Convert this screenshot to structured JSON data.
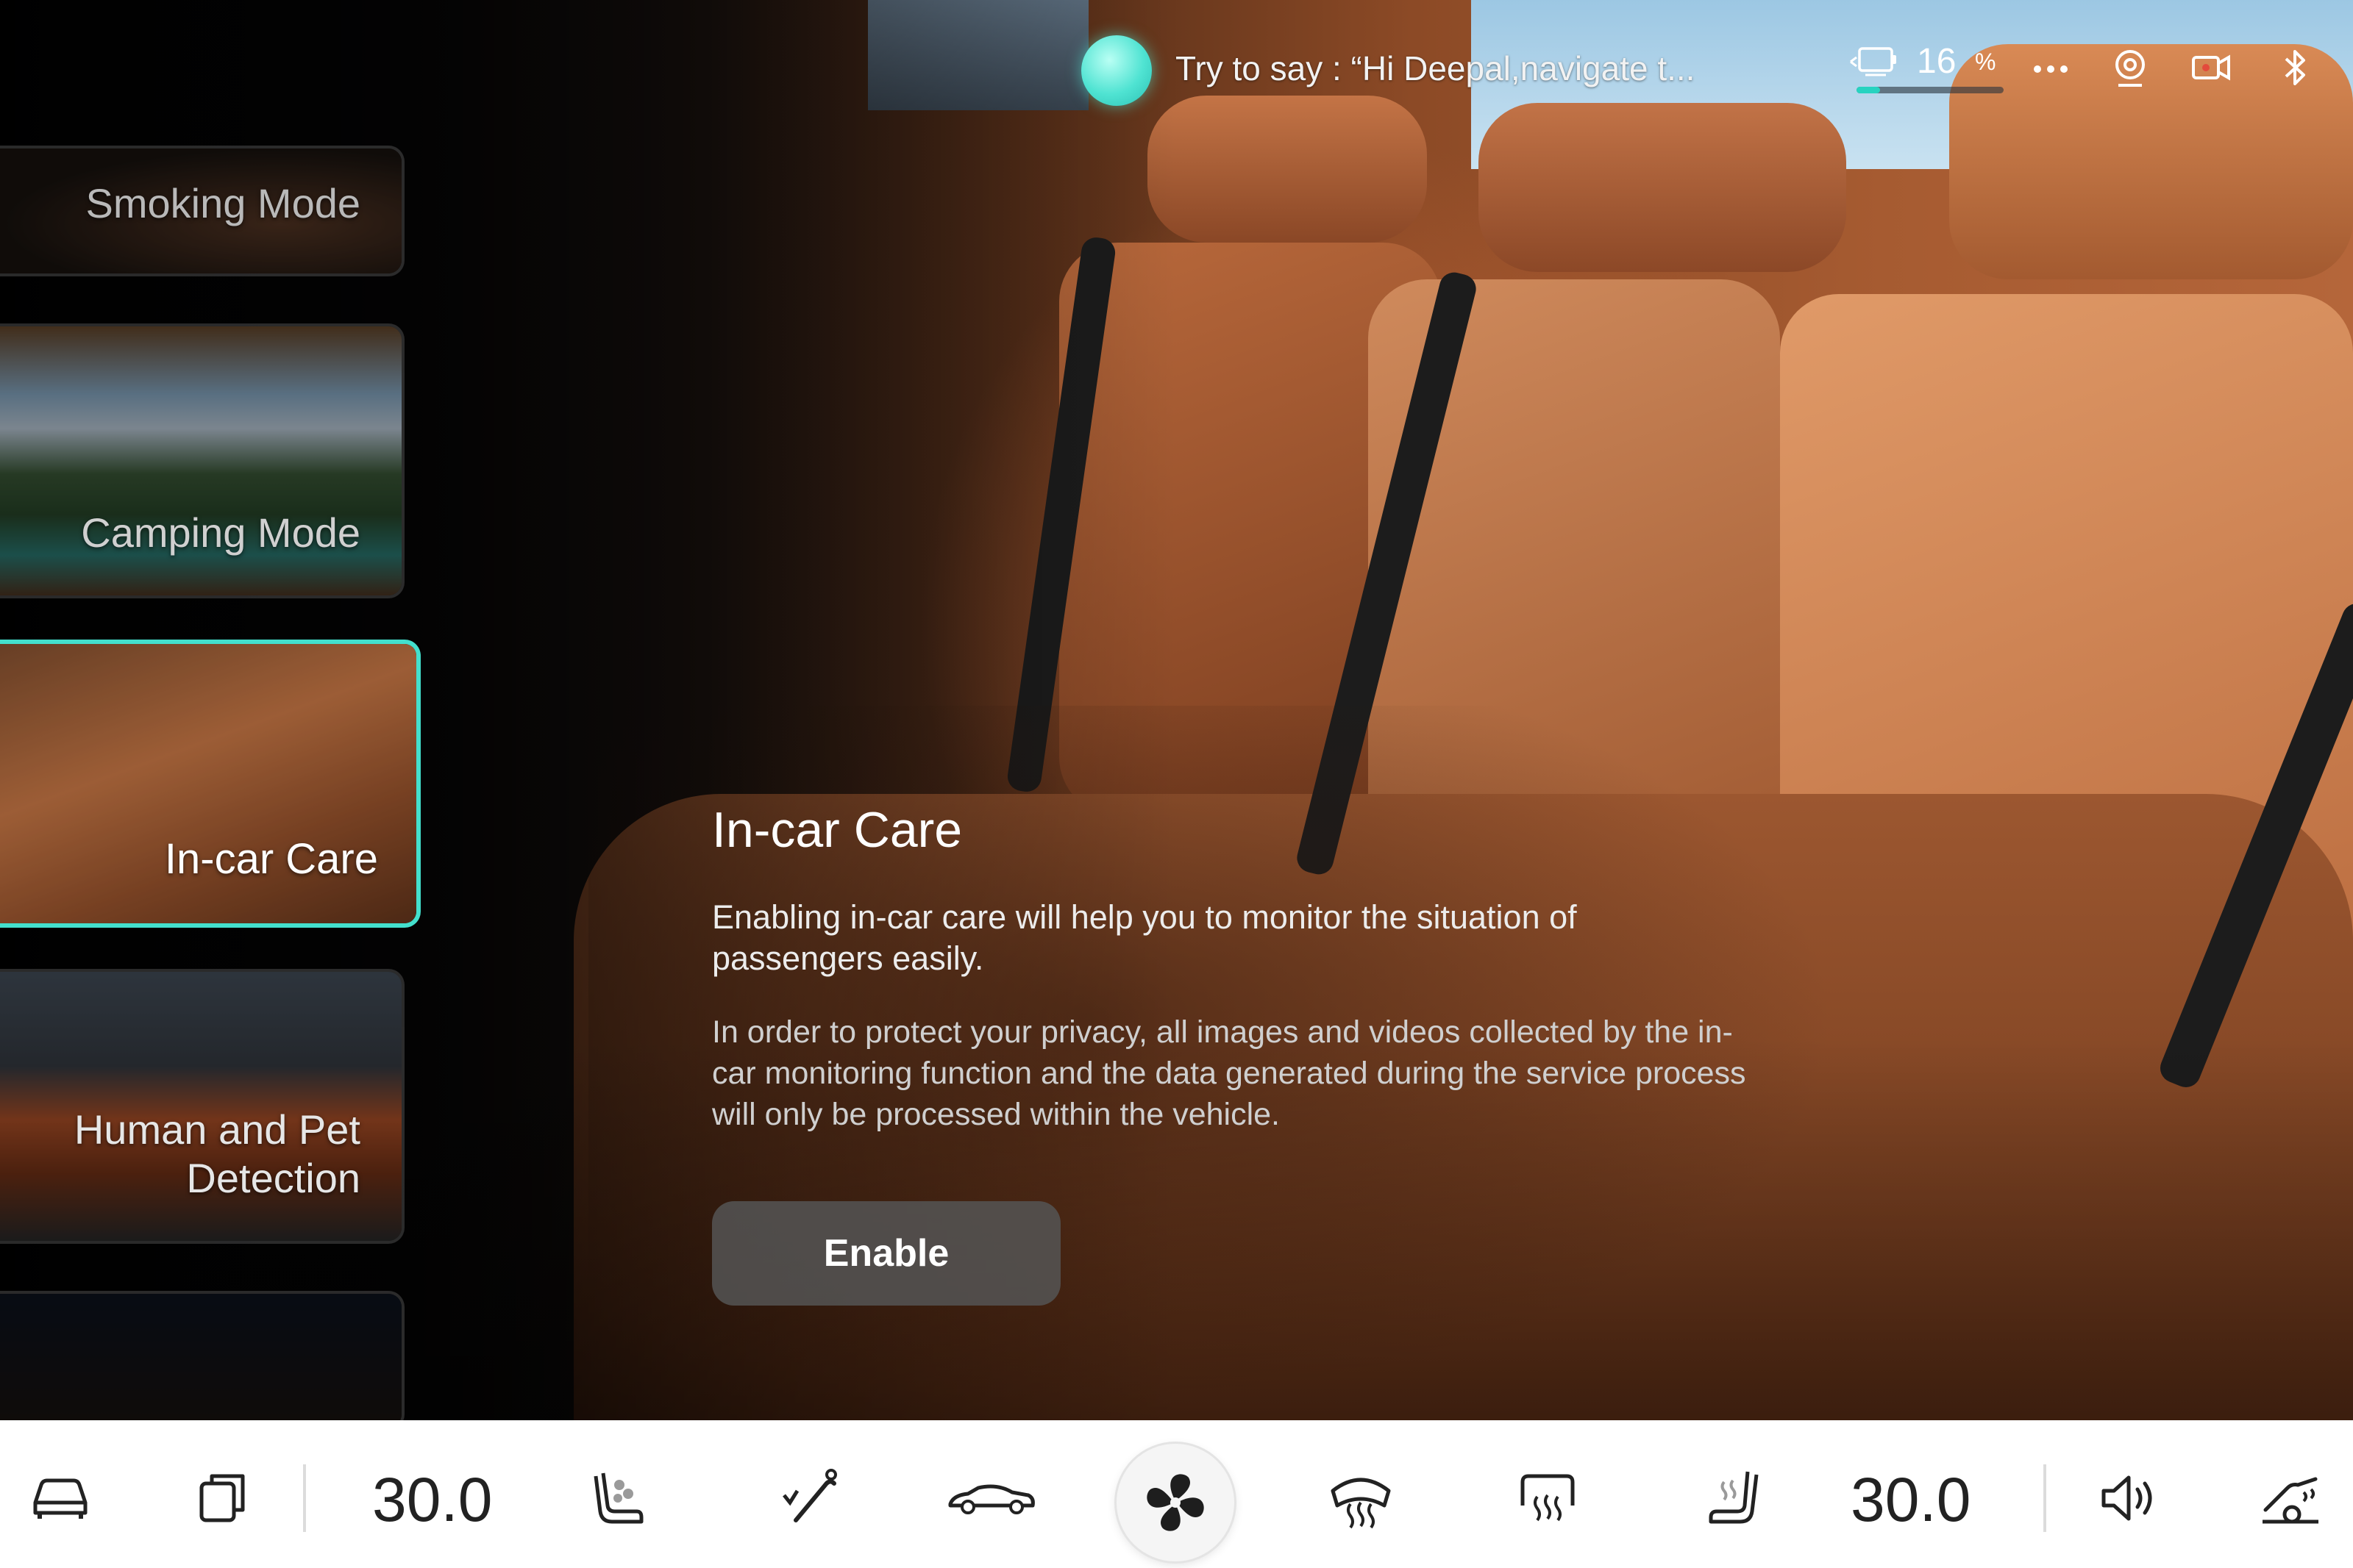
{
  "voice_assistant": {
    "hint": "Try to say : “Hi Deepal,navigate t..."
  },
  "status": {
    "battery_value": "16",
    "battery_unit": "%",
    "battery_level": 0.16,
    "icons": [
      "battery-icon",
      "more-icon",
      "driver-monitor-icon",
      "dashcam-icon",
      "bluetooth-icon"
    ]
  },
  "modes": [
    {
      "label": "Smoking Mode",
      "active": false
    },
    {
      "label": "Camping Mode",
      "active": false
    },
    {
      "label": "In-car Care",
      "active": true
    },
    {
      "label": "Human and Pet Detection",
      "active": false
    },
    {
      "label": "",
      "active": false
    }
  ],
  "content": {
    "title": "In-car Care",
    "description": "Enabling in-car care will help you to monitor the situation of passengers easily.",
    "privacy": "In order to protect your privacy, all images and videos collected by the in-car monitoring function and the data generated during the service process will only be processed within the vehicle.",
    "enable_label": "Enable"
  },
  "dock": {
    "driver_temp": "30.0",
    "passenger_temp": "30.0",
    "icons": [
      "car-icon",
      "windows-icon",
      "seat-heat-driver-icon",
      "seat-recline-icon",
      "convertible-car-icon",
      "fan-icon",
      "front-defrost-icon",
      "rear-defrost-icon",
      "seat-heat-passenger-icon",
      "volume-icon",
      "steering-heat-icon"
    ]
  },
  "colors": {
    "accent": "#43e0cd",
    "voice_orb": "#4fe3d2",
    "dock_bg": "#ffffff"
  }
}
